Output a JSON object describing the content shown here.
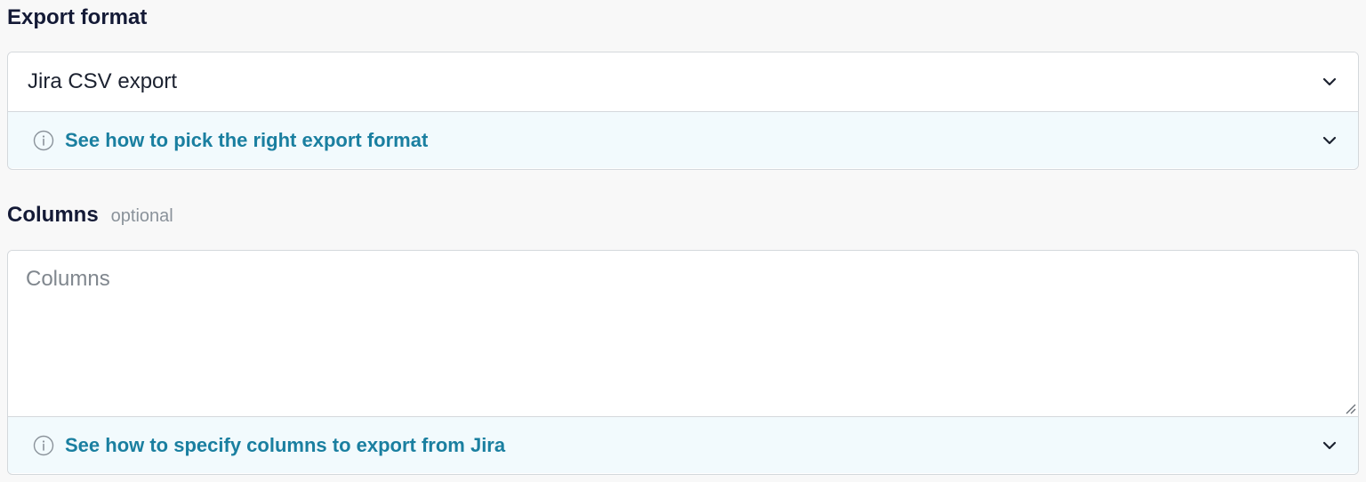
{
  "export_format": {
    "label": "Export format",
    "selected_value": "Jira CSV export",
    "help_text": "See how to pick the right export format"
  },
  "columns": {
    "label": "Columns",
    "optional_tag": "optional",
    "placeholder": "Columns",
    "value": "",
    "help_text": "See how to specify columns to export from Jira"
  },
  "icons": {
    "info": "info-circle-icon",
    "chevron": "chevron-down-icon"
  },
  "colors": {
    "link": "#1a7fa0",
    "help_background": "#f2fafd",
    "border": "#d4d8dc",
    "heading": "#141a36",
    "muted": "#8a929a"
  }
}
